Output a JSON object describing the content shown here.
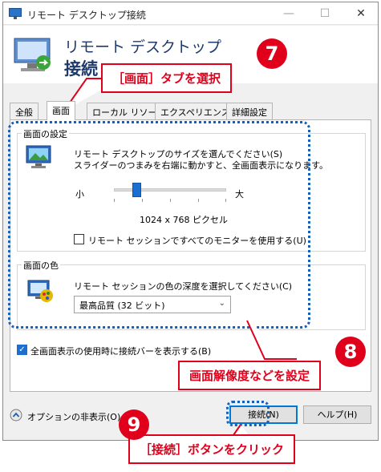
{
  "window": {
    "title": "リモート デスクトップ接続",
    "controls": {
      "minimize": "—",
      "maximize": "☐",
      "close": "✕"
    }
  },
  "banner": {
    "line1": "リモート デスクトップ",
    "line2": "接続"
  },
  "tabs": [
    {
      "label": "全般"
    },
    {
      "label": "画面"
    },
    {
      "label": "ローカル リソース"
    },
    {
      "label": "エクスペリエンス"
    },
    {
      "label": "詳細設定"
    }
  ],
  "display_settings": {
    "group_title": "画面の設定",
    "desc_line1": "リモート デスクトップのサイズを選んでください(S)",
    "desc_line2": "スライダーのつまみを右端に動かすと、全画面表示になります。",
    "slider_small": "小",
    "slider_large": "大",
    "resolution": "1024 x 768 ピクセル",
    "slider_value_percent": 20,
    "all_monitors_label": "リモート セッションですべてのモニターを使用する(U)",
    "all_monitors_checked": false
  },
  "colors": {
    "group_title": "画面の色",
    "desc": "リモート セッションの色の深度を選択してください(C)",
    "selected": "最高品質 (32 ビット)"
  },
  "connection_bar": {
    "label": "全画面表示の使用時に接続バーを表示する(B)",
    "checked": true
  },
  "footer": {
    "options_label": "オプションの非表示(O)",
    "connect_label": "接続(N)",
    "help_label": "ヘルプ(H)"
  },
  "annotations": {
    "step7": {
      "number": "7",
      "text": "［画面］タブを選択"
    },
    "step8": {
      "number": "8",
      "text": "画面解像度などを設定"
    },
    "step9": {
      "number": "9",
      "text": "［接続］ボタンをクリック"
    },
    "accent_color": "#e0001b",
    "highlight_color": "#1a5fb4"
  }
}
